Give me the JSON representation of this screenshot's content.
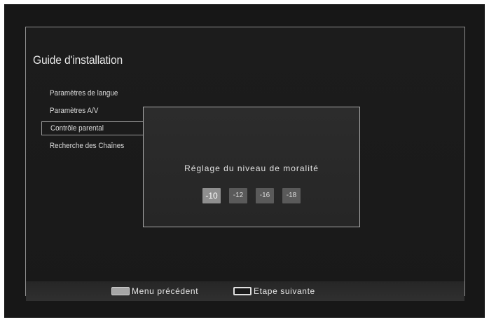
{
  "title": "Guide d'installation",
  "menu": {
    "items": [
      {
        "label": "Paramètres de langue"
      },
      {
        "label": "Paramètres A/V"
      },
      {
        "label": "Contrôle parental"
      },
      {
        "label": "Recherche des Chaînes"
      }
    ],
    "selected_index": 2
  },
  "dialog": {
    "title": "Réglage du niveau de moralité",
    "levels": [
      "-10",
      "-12",
      "-16",
      "-18"
    ],
    "selected_level": "-10"
  },
  "footer": {
    "back": {
      "label": "Menu précédent",
      "key_color": "gray"
    },
    "next": {
      "label": "Etape suivante",
      "key_color": "black"
    }
  }
}
